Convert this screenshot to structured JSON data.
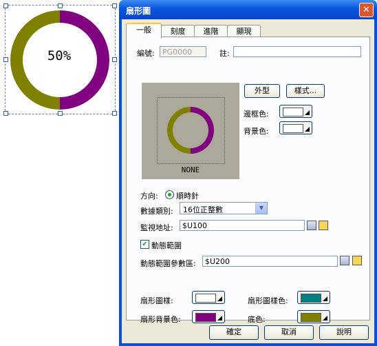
{
  "preview": {
    "percent_text": "50%",
    "ring_colors": {
      "left": "#808000",
      "right": "#800080"
    }
  },
  "dialog": {
    "title": "扇形圖",
    "close_glyph": "✕",
    "tabs": [
      {
        "label": "一般"
      },
      {
        "label": "刻度"
      },
      {
        "label": "進階"
      },
      {
        "label": "顯現"
      }
    ],
    "general": {
      "id_label": "編號:",
      "id_value": "PG0000",
      "note_label": "註:",
      "note_value": "",
      "appearance_button": "外型",
      "style_button": "樣式...",
      "border_color_label": "邊框色:",
      "bg_color_label": "背景色:",
      "inner_preview_label": "NONE",
      "direction_label": "方向:",
      "direction_option": "順時針",
      "data_type_label": "數據類別:",
      "data_type_value": "16位正整數",
      "monitor_addr_label": "監視地址:",
      "monitor_addr_value": "$U100",
      "dynamic_range_label": "動態範圍",
      "dynamic_range_param_label": "動態範圍參數區:",
      "dynamic_range_param_value": "$U200",
      "pie_style_label": "扇形圖樣:",
      "pie_style_color_label": "扇形圖樣色:",
      "pie_bg_color_label": "扇形背景色:",
      "base_color_label": "底色:"
    },
    "colors": {
      "border_color": "#ffffff",
      "bg_color": "#ffffff",
      "pie_style": "#ffffff",
      "pie_style_color": "#008080",
      "pie_bg_color": "#800080",
      "base_color": "#808000"
    },
    "footer": {
      "ok": "確定",
      "cancel": "取消",
      "help": "說明"
    }
  }
}
